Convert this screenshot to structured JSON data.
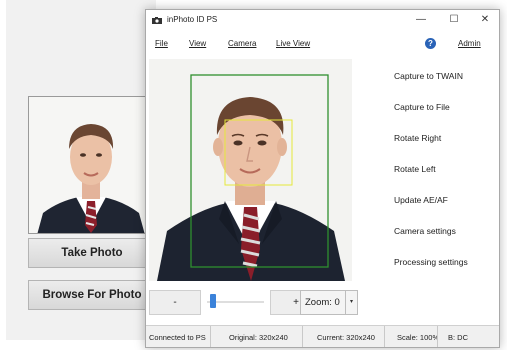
{
  "background_app": {
    "take_photo_label": "Take Photo",
    "browse_label": "Browse For Photo"
  },
  "window": {
    "title": "inPhoto ID PS",
    "controls": {
      "minimize": "—",
      "maximize": "☐",
      "close": "✕"
    }
  },
  "menu": {
    "file": "File",
    "view": "View",
    "camera": "Camera",
    "live_view": "Live View",
    "help_icon": "?",
    "admin": "Admin"
  },
  "actions": [
    "Capture to TWAIN",
    "Capture to File",
    "Rotate Right",
    "Rotate Left",
    "Update AE/AF",
    "Camera settings",
    "Processing settings"
  ],
  "controls": {
    "minus_label": "-",
    "plus_label": "+",
    "zoom_label": "Zoom: 0",
    "zoom_dropdown": "▾",
    "slider_position": 0.05
  },
  "status": {
    "connection": "Connected to PS",
    "original": "Original: 320x240",
    "current": "Current: 320x240",
    "scale": "Scale: 100%",
    "mode": "B: DC"
  },
  "colors": {
    "face_box": "#2f8f2f",
    "eye_box": "#e4e83b",
    "help_icon": "#2a63b7",
    "slider_thumb": "#3b82d9"
  }
}
